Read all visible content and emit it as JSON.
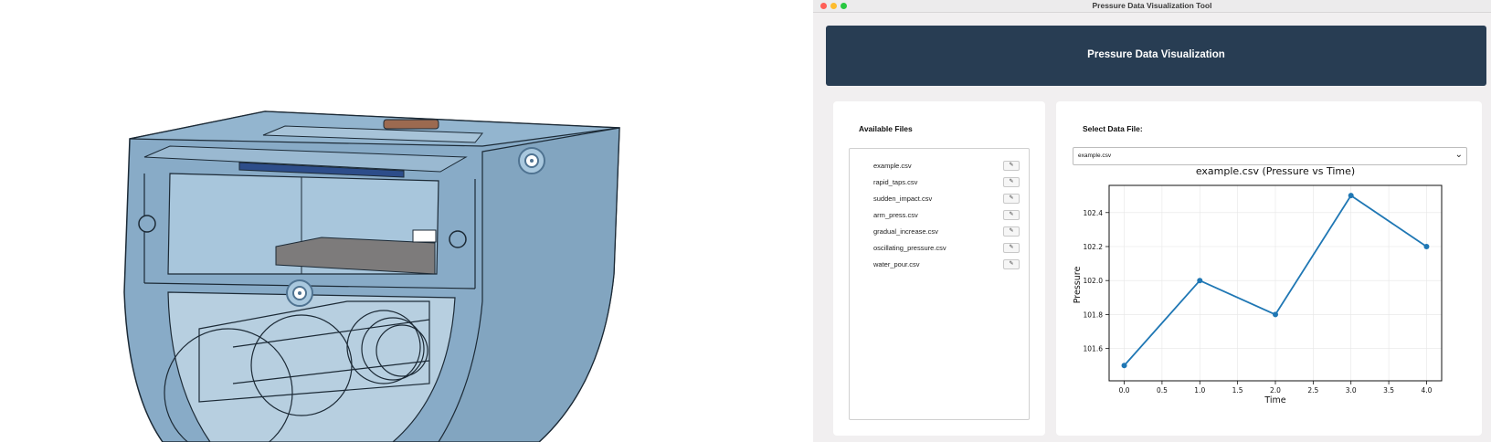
{
  "window": {
    "title": "Pressure Data Visualization Tool"
  },
  "header": {
    "title": "Pressure Data Visualization"
  },
  "files_panel": {
    "heading": "Available Files",
    "files": [
      {
        "name": "example.csv",
        "action_icon": "✎"
      },
      {
        "name": "rapid_taps.csv",
        "action_icon": "✎"
      },
      {
        "name": "sudden_impact.csv",
        "action_icon": "✎"
      },
      {
        "name": "arm_press.csv",
        "action_icon": "✎"
      },
      {
        "name": "gradual_increase.csv",
        "action_icon": "✎"
      },
      {
        "name": "oscillating_pressure.csv",
        "action_icon": "✎"
      },
      {
        "name": "water_pour.csv",
        "action_icon": "✎"
      }
    ]
  },
  "chart_panel": {
    "select_label": "Select Data File:",
    "selected_file": "example.csv"
  },
  "colors": {
    "header_bg": "#283d53",
    "line": "#1f77b4",
    "cad_body": "#88abc7"
  },
  "chart_data": {
    "type": "line",
    "title": "example.csv (Pressure vs Time)",
    "xlabel": "Time",
    "ylabel": "Pressure",
    "x": [
      0.0,
      1.0,
      2.0,
      3.0,
      4.0
    ],
    "series": [
      {
        "values": [
          101.5,
          102.0,
          101.8,
          102.5,
          102.2
        ]
      }
    ],
    "xlim": [
      -0.2,
      4.2
    ],
    "ylim": [
      101.41,
      102.56
    ],
    "xticks": [
      "0.0",
      "0.5",
      "1.0",
      "1.5",
      "2.0",
      "2.5",
      "3.0",
      "3.5",
      "4.0"
    ],
    "yticks": [
      "101.6",
      "101.8",
      "102.0",
      "102.2",
      "102.4"
    ],
    "grid": true,
    "markers": true
  }
}
